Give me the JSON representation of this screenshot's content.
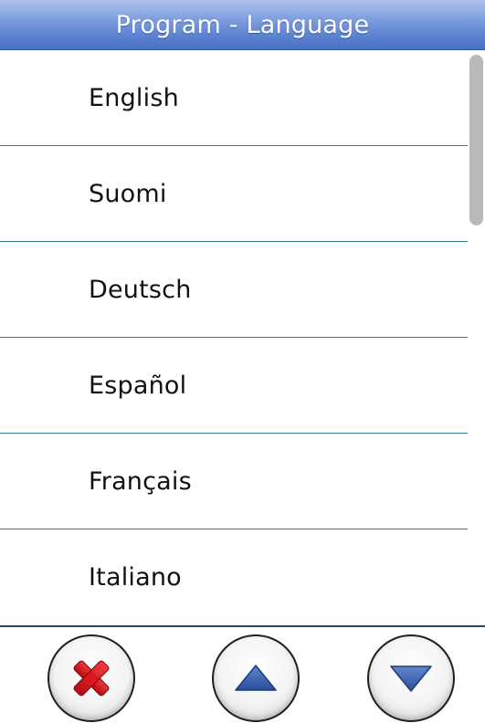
{
  "header": {
    "title": "Program - Language"
  },
  "languages": [
    {
      "label": "English"
    },
    {
      "label": "Suomi"
    },
    {
      "label": "Deutsch"
    },
    {
      "label": "Español"
    },
    {
      "label": "Français"
    },
    {
      "label": "Italiano"
    }
  ],
  "toolbar": {
    "cancel_icon": "close-x-icon",
    "up_icon": "triangle-up-icon",
    "down_icon": "triangle-down-icon"
  },
  "colors": {
    "header_top": "#aec3ec",
    "header_bottom": "#4a70c2",
    "divider": "#2f7f8d",
    "cancel_red": "#d0141a",
    "arrow_blue": "#3f67b5",
    "scroll_thumb": "#b9b9b9"
  }
}
